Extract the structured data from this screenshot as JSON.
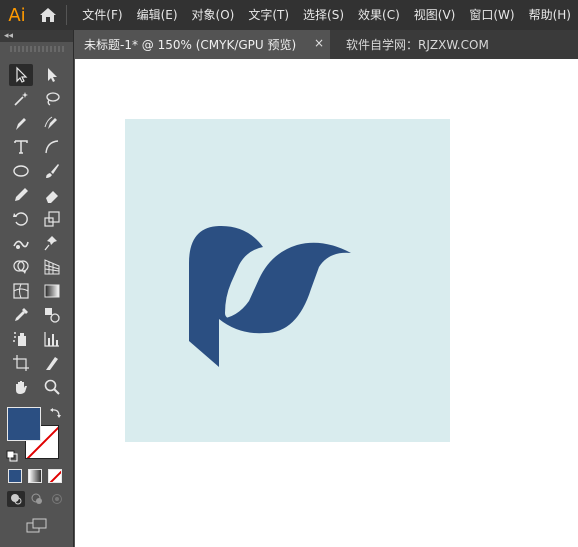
{
  "app": {
    "logo_text": "Ai"
  },
  "menu": {
    "items": [
      {
        "label": "文件(F)"
      },
      {
        "label": "编辑(E)"
      },
      {
        "label": "对象(O)"
      },
      {
        "label": "文字(T)"
      },
      {
        "label": "选择(S)"
      },
      {
        "label": "效果(C)"
      },
      {
        "label": "视图(V)"
      },
      {
        "label": "窗口(W)"
      },
      {
        "label": "帮助(H)"
      }
    ]
  },
  "tabs": {
    "active": {
      "label": "未标题-1* @ 150% (CMYK/GPU 预览)",
      "close": "×"
    },
    "second": {
      "label": "软件自学网：RJZXW.COM"
    }
  },
  "tools_panel": {
    "collapse_label": "◂◂"
  },
  "colors": {
    "fill": "#2b4f82",
    "artboard_bg": "#d9ecee",
    "logo_color": "#2b4f82",
    "accent": "#ff9a00"
  }
}
